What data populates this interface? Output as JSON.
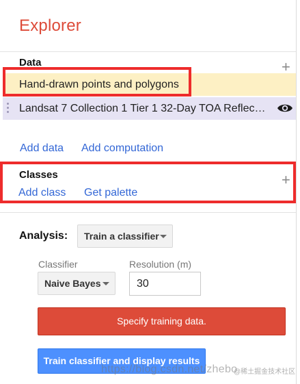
{
  "app": {
    "title": "Explorer"
  },
  "data_section": {
    "label": "Data",
    "layers": [
      {
        "name": "Hand-drawn points and polygons"
      },
      {
        "name": "Landsat 7 Collection 1 Tier 1 32-Day TOA Reflec…",
        "icon": "eye-icon"
      }
    ],
    "add_data": "Add data",
    "add_computation": "Add computation"
  },
  "classes_section": {
    "label": "Classes",
    "add_class": "Add class",
    "get_palette": "Get palette"
  },
  "analysis": {
    "label": "Analysis:",
    "type_selected": "Train a classifier",
    "classifier_label": "Classifier",
    "classifier_selected": "Naive Bayes",
    "resolution_label": "Resolution (m)",
    "resolution_value": "30",
    "error_message": "Specify training data.",
    "train_button": "Train classifier and display results"
  },
  "watermark": {
    "url": "https://blog.csdn.net/zhebo",
    "badge": "@稀土掘金技术社区"
  },
  "colors": {
    "title": "#dd4b39",
    "link": "#3367d6",
    "highlight_box": "#ee2c2c",
    "hand_drawn_row": "#fdf0c4",
    "landsat_row": "#e6e3f4",
    "error": "#dd4b39",
    "primary_button": "#4d90fe"
  }
}
